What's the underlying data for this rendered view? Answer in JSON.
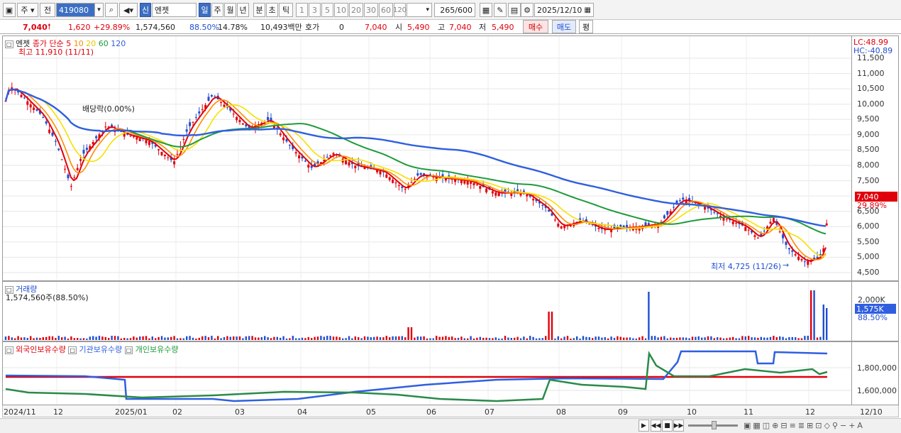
{
  "toolbar": {
    "mode_label": "주",
    "period_label": "전",
    "code": "419080",
    "tag_new": "신",
    "name": "엔젯",
    "periods": [
      "일",
      "주",
      "월",
      "년",
      "분",
      "초",
      "틱"
    ],
    "numbers": [
      "1",
      "3",
      "5",
      "10",
      "20",
      "30",
      "60",
      "120"
    ],
    "count": "265",
    "total": "/600",
    "date": "2025/12/10"
  },
  "quote": {
    "price": "7,040",
    "change": "1,620",
    "pct": "+29.89%",
    "volume": "1,574,560",
    "vol_ratio": "88.50%",
    "turnover": "14.78%",
    "amount": "10,493백만",
    "hoga_label": "호가",
    "hoga": "0",
    "hoga_price": "7,040",
    "open_label": "시",
    "open": "5,490",
    "high_label": "고",
    "high": "7,040",
    "low_label": "저",
    "low": "5,490",
    "buy": "매수",
    "sell": "매도",
    "eval": "평"
  },
  "price_panel": {
    "name": "엔젯",
    "ma_title": "종가 단순",
    "ma_periods": [
      "5",
      "10",
      "20",
      "60",
      "120"
    ],
    "ma_colors": [
      "#e0000b",
      "#ff8c00",
      "#f5e100",
      "#1f9a3b",
      "#2f5fe0"
    ],
    "high_note": "최고 11,910 (11/11)",
    "low_note": "최저 4,725 (11/26)",
    "div_note": "배당락(0.00%)",
    "lc": "LC:48.99",
    "hc": "HC:-40.89",
    "last_price": "7,040",
    "last_pct": "29.89%",
    "yticks": [
      "11,500",
      "11,000",
      "10,500",
      "10,000",
      "9,500",
      "9,000",
      "8,500",
      "8,000",
      "7,500",
      "7,000",
      "6,500",
      "6,000",
      "5,500",
      "5,000",
      "4,500"
    ]
  },
  "volume_panel": {
    "title": "거래량",
    "value": "1,574,560주(88.50%)",
    "yticks": [
      "2,000K",
      "1,575K",
      "88.50%"
    ]
  },
  "holding_panel": {
    "legend": [
      "외국인보유수량",
      "기관보유수량",
      "개인보유수량"
    ],
    "legend_colors": [
      "#e0000b",
      "#2f5fe0",
      "#1f9a3b"
    ],
    "yticks": [
      "1,800,000",
      "1,600,000"
    ]
  },
  "xaxis": [
    "2024/11",
    "12",
    "2025/01",
    "02",
    "03",
    "04",
    "05",
    "06",
    "07",
    "08",
    "09",
    "10",
    "11",
    "12",
    "12/10"
  ],
  "colors": {
    "up": "#e0000b",
    "down": "#1f4ed0",
    "accent": "#3c6fc4"
  }
}
